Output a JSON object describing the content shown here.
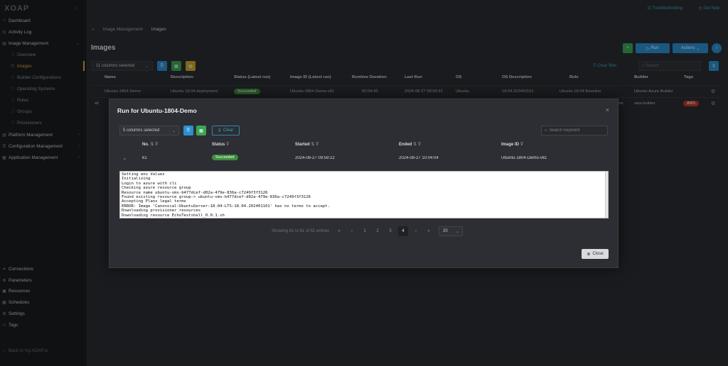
{
  "app": {
    "logo": "XOAP",
    "top_links": [
      "Troubleshooting",
      "Get help"
    ]
  },
  "sidebar": {
    "items": [
      {
        "label": "Dashboard",
        "icon": "home-icon"
      },
      {
        "label": "Activity Log",
        "icon": "clock-icon"
      },
      {
        "label": "Image Management",
        "icon": "layers-icon"
      },
      {
        "label": "Overview",
        "icon": "dot-icon"
      },
      {
        "label": "Images",
        "icon": "dot-icon"
      },
      {
        "label": "Builder Configurations",
        "icon": "dot-icon"
      },
      {
        "label": "Operating Systems",
        "icon": "dot-icon"
      },
      {
        "label": "Roles",
        "icon": "dot-icon"
      },
      {
        "label": "Groups",
        "icon": "dot-icon"
      },
      {
        "label": "Provisioners",
        "icon": "dot-icon"
      },
      {
        "label": "Platform Management",
        "icon": "layers-icon"
      },
      {
        "label": "Configuration Management",
        "icon": "sliders-icon"
      },
      {
        "label": "Application Management",
        "icon": "grid-icon"
      }
    ],
    "bottom_items": [
      {
        "label": "Connections",
        "icon": "link-icon"
      },
      {
        "label": "Parameters",
        "icon": "list-icon"
      },
      {
        "label": "Resources",
        "icon": "box-icon"
      },
      {
        "label": "Schedules",
        "icon": "calendar-icon"
      },
      {
        "label": "Settings",
        "icon": "gear-icon"
      },
      {
        "label": "Tags",
        "icon": "tag-icon"
      }
    ],
    "back_link": "Back to my.XOAP.io"
  },
  "breadcrumb": [
    "Image Management",
    "Images"
  ],
  "page": {
    "title": "Images",
    "run_label": "Run",
    "actions_label": "Actions",
    "columns_selected": "11 columns selected",
    "clear_filter": "Clear filter",
    "search_placeholder": "Search"
  },
  "table": {
    "headers": [
      "Name",
      "Description",
      "Status (Latest run)",
      "Image ID (Latest run)",
      "Runtime Duration",
      "Last Run",
      "OS",
      "OS Description",
      "Role",
      "Builder",
      "Tags"
    ],
    "rows": [
      {
        "name": "Ubuntu-1804-Demo",
        "description": "Ubuntu 18.04 deployment",
        "status": "Succeeded",
        "image_id": "Ubuntu-1804-Demo-v61",
        "duration": "00:04:43",
        "last_run": "2024-08-27 09:59:22",
        "os": "Ubuntu",
        "os_desc": "18.04.202401161",
        "role": "Ubuntu 18.04 Baseline",
        "builder": "Ubuntu Azure Builder",
        "tag": ""
      },
      {
        "name": "sit",
        "description": "",
        "status": "",
        "image_id": "",
        "duration": "",
        "last_run": "",
        "os": "",
        "os_desc": "",
        "role": "ine",
        "builder": "aws-builder",
        "tag": "AWS"
      }
    ]
  },
  "modal": {
    "title": "Run for Ubuntu-1804-Demo",
    "columns_selected": "5 columns selected",
    "clear_label": "Clear",
    "search_placeholder": "Search keyword",
    "headers": [
      "No.",
      "Status",
      "Started",
      "Ended",
      "Image ID"
    ],
    "row": {
      "no": "61",
      "status": "Succeeded",
      "started": "2024-08-27 09:59:22",
      "ended": "2024-08-27 10:04:04",
      "image_id": "Ubuntu-1804-Demo-v61"
    },
    "log": "Setting env Values\nInitializing\nLogin to azure with cli\nChecking azure resource group\nResource name ubuntu-vms-b477dcef-d02a-479e-836a-c7249f3f3126\nFound existing resource group-> ubuntu-vms-b477dcef-d02a-479e-836a-c7249f3f3126\nAccepting Plans legal terms\nERROR: Image 'Canonical:UbuntuServer:18.04-LTS:18.04.202401161' has no terms to accept.\nDownloading provisioner resources\nDownloading resource EchoTestshell_0.0.1.sh",
    "pagination": {
      "summary": "Showing 61 to 61 of 61 entries",
      "pages": [
        "1",
        "2",
        "3",
        "4"
      ],
      "current": "4",
      "page_size": "20"
    },
    "close_label": "Close"
  },
  "colors": {
    "accent": "#d9a53a",
    "primary": "#2b8fd0",
    "success": "#3c8d3c",
    "danger": "#c0392b",
    "green_btn": "#3aa655"
  }
}
